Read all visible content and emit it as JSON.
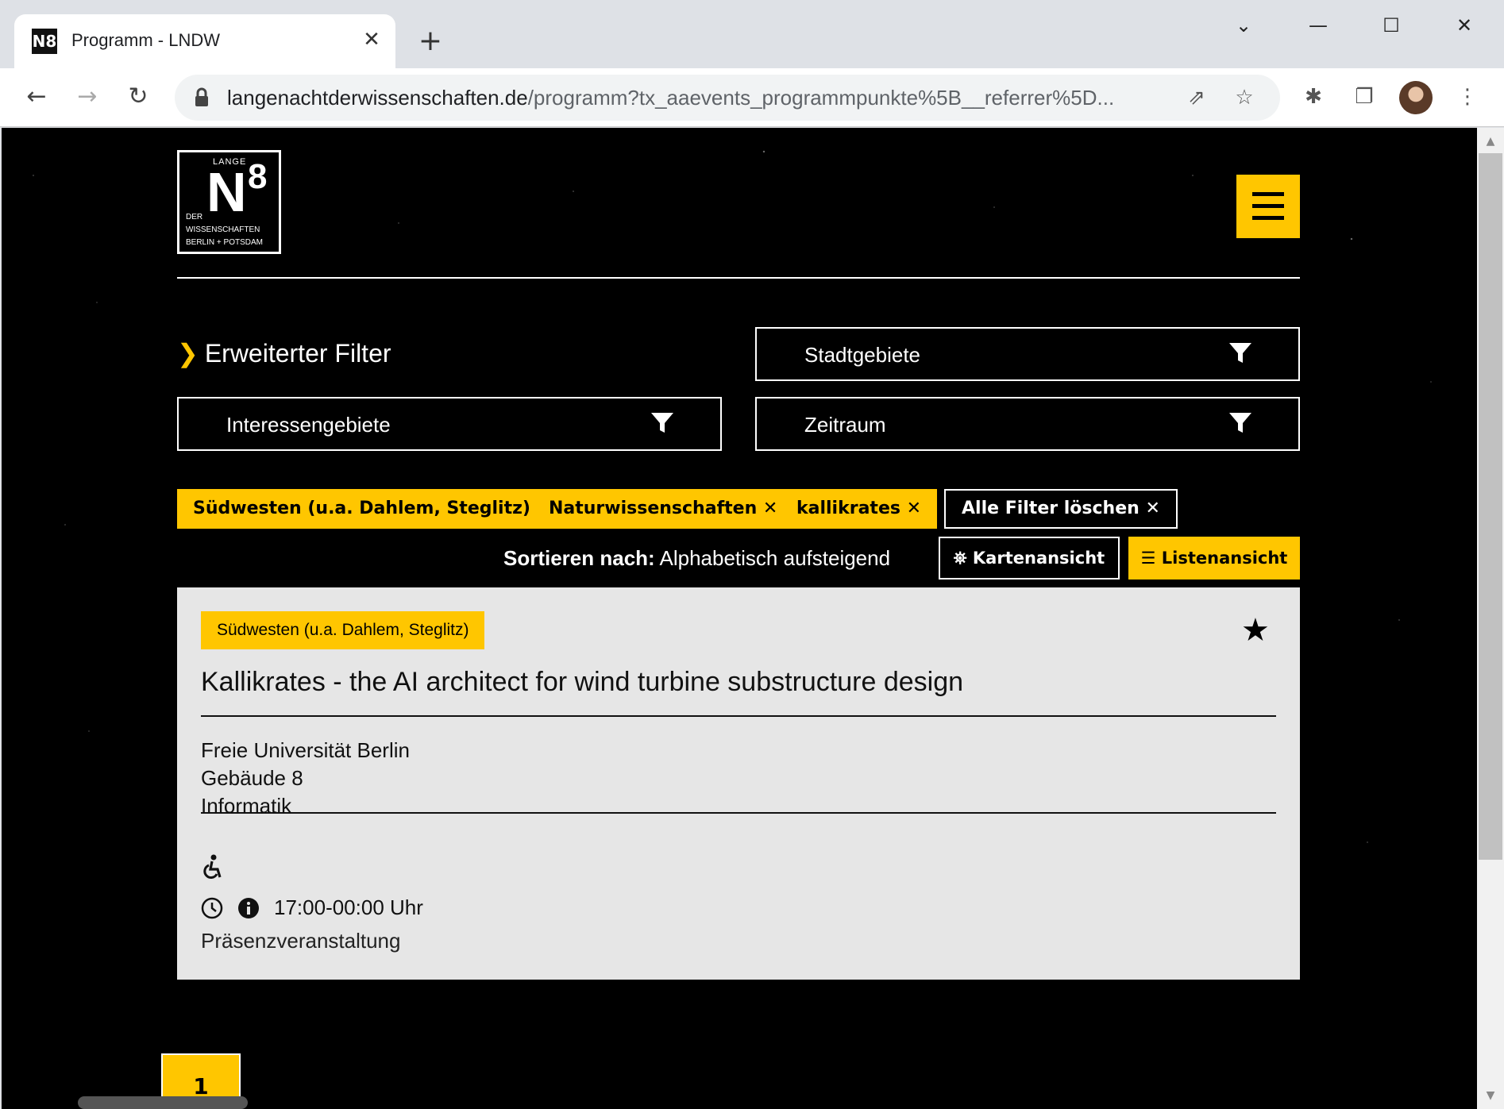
{
  "browser": {
    "tab_title": "Programm - LNDW",
    "favicon_text": "N8",
    "close_glyph": "✕",
    "new_tab_glyph": "+",
    "url_domain": "langenachtderwissenschaften.de",
    "url_path": "/programm?tx_aaevents_programmpunkte%5B__referrer%5D..."
  },
  "header": {
    "logo": {
      "lange": "LANGE",
      "n": "N",
      "eight": "8",
      "line1": "DER",
      "line2": "WISSENSCHAFTEN",
      "line3": "BERLIN + POTSDAM"
    }
  },
  "filters": {
    "advanced_label": "Erweiterter Filter",
    "stadtgebiete": "Stadtgebiete",
    "interessengebiete": "Interessengebiete",
    "zeitraum": "Zeitraum"
  },
  "active_filters": [
    "Südwesten (u.a. Dahlem, Steglitz)",
    "Naturwissenschaften",
    "kallikrates"
  ],
  "clear_all_label": "Alle Filter löschen",
  "sort": {
    "label": "Sortieren nach:",
    "value": "Alphabetisch aufsteigend"
  },
  "views": {
    "map_label": "Kartenansicht",
    "list_label": "Listenansicht"
  },
  "event": {
    "region": "Südwesten (u.a. Dahlem, Steglitz)",
    "title": "Kallikrates - the AI architect for wind turbine substructure design",
    "venue_line1": "Freie Universität Berlin",
    "venue_line2": "Gebäude 8",
    "venue_line3": "Informatik",
    "time": "17:00-00:00 Uhr",
    "format": "Präsenzveranstaltung"
  },
  "pagination": {
    "current_page": "1"
  },
  "colors": {
    "accent": "#ffc600",
    "background": "#000000",
    "card": "#e6e6e6"
  }
}
